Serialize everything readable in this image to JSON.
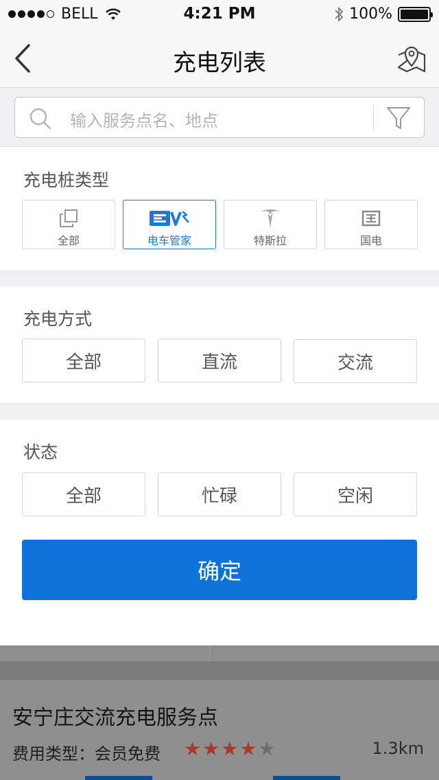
{
  "status_bar": {
    "carrier": "BELL",
    "time": "4:21 PM",
    "battery": "100%"
  },
  "nav": {
    "title": "充电列表"
  },
  "search": {
    "placeholder": "输入服务点名、地点"
  },
  "charger_type": {
    "title": "充电桩类型",
    "options": [
      {
        "label": "全部",
        "icon": "copy-icon"
      },
      {
        "label": "电车管家",
        "icon": "ev-logo-icon",
        "selected": true
      },
      {
        "label": "特斯拉",
        "icon": "tesla-logo-icon"
      },
      {
        "label": "国电",
        "icon": "state-grid-logo-icon"
      }
    ]
  },
  "charge_mode": {
    "title": "充电方式",
    "options": [
      "全部",
      "直流",
      "交流"
    ]
  },
  "status": {
    "title": "状态",
    "options": [
      "全部",
      "忙碌",
      "空闲"
    ]
  },
  "confirm_label": "确定",
  "background_list": {
    "name": "安宁庄交流充电服务点",
    "fee": "费用类型：会员免费",
    "rating": 4,
    "rating_max": 5,
    "distance": "1.3km"
  },
  "colors": {
    "accent": "#0c72d9",
    "star": "#c0392b"
  }
}
